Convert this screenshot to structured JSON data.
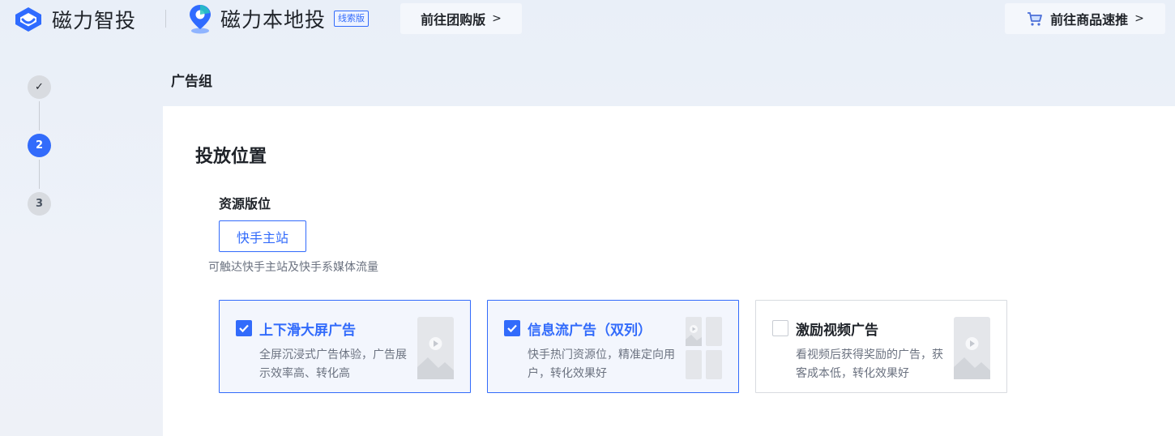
{
  "header": {
    "brand_primary": "磁力智投",
    "brand_secondary": "磁力本地投",
    "brand_tag": "线索版",
    "group_link_label": "前往团购版",
    "product_link_label": "前往商品速推"
  },
  "steps": [
    {
      "label": "✓",
      "state": "done"
    },
    {
      "label": "2",
      "state": "active"
    },
    {
      "label": "3",
      "state": "todo"
    }
  ],
  "section_label": "广告组",
  "placement": {
    "title": "投放位置",
    "resource_label": "资源版位",
    "site_button": "快手主站",
    "site_desc": "可触达快手主站及快手系媒体流量",
    "options": [
      {
        "title": "上下滑大屏广告",
        "desc": "全屏沉浸式广告体验，广告展示效率高、转化高",
        "checked": true
      },
      {
        "title": "信息流广告（双列）",
        "desc": "快手热门资源位，精准定向用户，转化效果好",
        "checked": true
      },
      {
        "title": "激励视频广告",
        "desc": "看视频后获得奖励的广告，获客成本低，转化效果好",
        "checked": false
      }
    ]
  },
  "colors": {
    "accent": "#326bfb",
    "text_primary": "#1f2329",
    "text_secondary": "#6b7280"
  }
}
